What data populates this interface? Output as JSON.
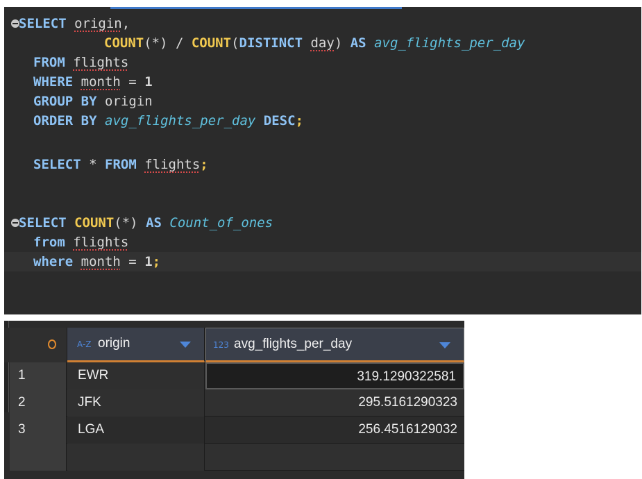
{
  "editor": {
    "lines": [
      {
        "id": "l1",
        "text": "SELECT origin,"
      },
      {
        "id": "l2",
        "text": "COUNT(*) / COUNT(DISTINCT day) AS avg_flights_per_day"
      },
      {
        "id": "l3",
        "text": "FROM flights"
      },
      {
        "id": "l4",
        "text": "WHERE month = 1"
      },
      {
        "id": "l5",
        "text": "GROUP BY origin"
      },
      {
        "id": "l6",
        "text": "ORDER BY avg_flights_per_day DESC;"
      },
      {
        "id": "l7",
        "text": "SELECT * FROM flights;"
      },
      {
        "id": "l8",
        "text": "SELECT COUNT(*) AS Count_of_ones"
      },
      {
        "id": "l9",
        "text": "from flights"
      },
      {
        "id": "l10",
        "text": "where month = 1;"
      }
    ],
    "tokens": {
      "select": "SELECT",
      "origin": "origin",
      "comma": ",",
      "count": "COUNT",
      "star_paren": "(*)",
      "slash": " / ",
      "lparen": "(",
      "distinct": "DISTINCT",
      "day": "day",
      "rparen": ")",
      "as": "AS",
      "avg_alias": "avg_flights_per_day",
      "from": "FROM",
      "flights": "flights",
      "where": "WHERE",
      "month": "month",
      "eq": " = ",
      "one": "1",
      "group": "GROUP",
      "by": "BY",
      "order": "ORDER",
      "desc": "DESC",
      "semi": ";",
      "star": "*",
      "count_alias": "Count_of_ones",
      "from_lower": "from",
      "where_lower": "where"
    }
  },
  "results": {
    "columns": [
      {
        "type_icon": "A-Z",
        "name": "origin"
      },
      {
        "type_icon": "123",
        "name": "avg_flights_per_day"
      }
    ],
    "rows": [
      {
        "num": "1",
        "origin": "EWR",
        "avg": "319.1290322581"
      },
      {
        "num": "2",
        "origin": "JFK",
        "avg": "295.5161290323"
      },
      {
        "num": "3",
        "origin": "LGA",
        "avg": "256.4516129032"
      }
    ],
    "icons": {
      "corner": "row-count-ring-icon",
      "sort": "sort-dropdown-icon",
      "fold": "fold-collapse-icon"
    },
    "colors": {
      "keyword": "#8ec3f5",
      "function": "#f1c950",
      "alias": "#5fc0dd",
      "accent": "#d08033"
    }
  }
}
